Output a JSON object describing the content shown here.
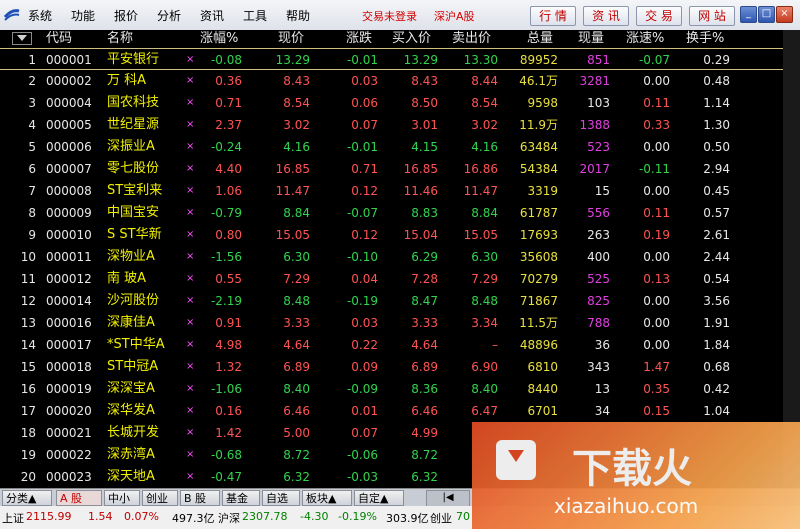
{
  "menu": [
    "系统",
    "功能",
    "报价",
    "分析",
    "资讯",
    "工具",
    "帮助"
  ],
  "status": {
    "trade_login": "交易未登录",
    "market": "深沪A股"
  },
  "toolbar": {
    "quote": "行 情",
    "info": "资 讯",
    "trade": "交 易",
    "site": "网 站"
  },
  "window_buttons": {
    "minimize": "_",
    "maximize": "□",
    "close": "×"
  },
  "columns": {
    "code": "代码",
    "name": "名称",
    "pct": "涨幅%",
    "price": "现价",
    "chg": "涨跌",
    "bid": "买入价",
    "ask": "卖出价",
    "vol": "总量",
    "cur": "现量",
    "spd": "涨速%",
    "turn": "换手%"
  },
  "rows": [
    {
      "idx": "1",
      "code": "000001",
      "name": "平安银行",
      "pct": "-0.08",
      "price": "13.29",
      "chg": "-0.01",
      "bid": "13.29",
      "ask": "13.30",
      "vol": "89952",
      "cur": "851",
      "spd": "-0.07",
      "turn": "0.29"
    },
    {
      "idx": "2",
      "code": "000002",
      "name": "万  科A",
      "pct": "0.36",
      "price": "8.43",
      "chg": "0.03",
      "bid": "8.43",
      "ask": "8.44",
      "vol": "46.1万",
      "cur": "3281",
      "spd": "0.00",
      "turn": "0.48"
    },
    {
      "idx": "3",
      "code": "000004",
      "name": "国农科技",
      "pct": "0.71",
      "price": "8.54",
      "chg": "0.06",
      "bid": "8.50",
      "ask": "8.54",
      "vol": "9598",
      "cur": "103",
      "spd": "0.11",
      "turn": "1.14"
    },
    {
      "idx": "4",
      "code": "000005",
      "name": "世纪星源",
      "pct": "2.37",
      "price": "3.02",
      "chg": "0.07",
      "bid": "3.01",
      "ask": "3.02",
      "vol": "11.9万",
      "cur": "1388",
      "spd": "0.33",
      "turn": "1.30"
    },
    {
      "idx": "5",
      "code": "000006",
      "name": "深振业A",
      "pct": "-0.24",
      "price": "4.16",
      "chg": "-0.01",
      "bid": "4.15",
      "ask": "4.16",
      "vol": "63484",
      "cur": "523",
      "spd": "0.00",
      "turn": "0.50"
    },
    {
      "idx": "6",
      "code": "000007",
      "name": "零七股份",
      "pct": "4.40",
      "price": "16.85",
      "chg": "0.71",
      "bid": "16.85",
      "ask": "16.86",
      "vol": "54384",
      "cur": "2017",
      "spd": "-0.11",
      "turn": "2.94"
    },
    {
      "idx": "7",
      "code": "000008",
      "name": "ST宝利来",
      "pct": "1.06",
      "price": "11.47",
      "chg": "0.12",
      "bid": "11.46",
      "ask": "11.47",
      "vol": "3319",
      "cur": "15",
      "spd": "0.00",
      "turn": "0.45"
    },
    {
      "idx": "8",
      "code": "000009",
      "name": "中国宝安",
      "pct": "-0.79",
      "price": "8.84",
      "chg": "-0.07",
      "bid": "8.83",
      "ask": "8.84",
      "vol": "61787",
      "cur": "556",
      "spd": "0.11",
      "turn": "0.57"
    },
    {
      "idx": "9",
      "code": "000010",
      "name": "S ST华新",
      "pct": "0.80",
      "price": "15.05",
      "chg": "0.12",
      "bid": "15.04",
      "ask": "15.05",
      "vol": "17693",
      "cur": "263",
      "spd": "0.19",
      "turn": "2.61"
    },
    {
      "idx": "10",
      "code": "000011",
      "name": "深物业A",
      "pct": "-1.56",
      "price": "6.30",
      "chg": "-0.10",
      "bid": "6.29",
      "ask": "6.30",
      "vol": "35608",
      "cur": "400",
      "spd": "0.00",
      "turn": "2.44"
    },
    {
      "idx": "11",
      "code": "000012",
      "name": "南  玻A",
      "pct": "0.55",
      "price": "7.29",
      "chg": "0.04",
      "bid": "7.28",
      "ask": "7.29",
      "vol": "70279",
      "cur": "525",
      "spd": "0.13",
      "turn": "0.54"
    },
    {
      "idx": "12",
      "code": "000014",
      "name": "沙河股份",
      "pct": "-2.19",
      "price": "8.48",
      "chg": "-0.19",
      "bid": "8.47",
      "ask": "8.48",
      "vol": "71867",
      "cur": "825",
      "spd": "0.00",
      "turn": "3.56"
    },
    {
      "idx": "13",
      "code": "000016",
      "name": "深康佳A",
      "pct": "0.91",
      "price": "3.33",
      "chg": "0.03",
      "bid": "3.33",
      "ask": "3.34",
      "vol": "11.5万",
      "cur": "788",
      "spd": "0.00",
      "turn": "1.91"
    },
    {
      "idx": "14",
      "code": "000017",
      "name": "*ST中华A",
      "pct": "4.98",
      "price": "4.64",
      "chg": "0.22",
      "bid": "4.64",
      "ask": "–",
      "vol": "48896",
      "cur": "36",
      "spd": "0.00",
      "turn": "1.84"
    },
    {
      "idx": "15",
      "code": "000018",
      "name": "ST中冠A",
      "pct": "1.32",
      "price": "6.89",
      "chg": "0.09",
      "bid": "6.89",
      "ask": "6.90",
      "vol": "6810",
      "cur": "343",
      "spd": "1.47",
      "turn": "0.68"
    },
    {
      "idx": "16",
      "code": "000019",
      "name": "深深宝A",
      "pct": "-1.06",
      "price": "8.40",
      "chg": "-0.09",
      "bid": "8.36",
      "ask": "8.40",
      "vol": "8440",
      "cur": "13",
      "spd": "0.35",
      "turn": "0.42"
    },
    {
      "idx": "17",
      "code": "000020",
      "name": "深华发A",
      "pct": "0.16",
      "price": "6.46",
      "chg": "0.01",
      "bid": "6.46",
      "ask": "6.47",
      "vol": "6701",
      "cur": "34",
      "spd": "0.15",
      "turn": "1.04"
    },
    {
      "idx": "18",
      "code": "000021",
      "name": "长城开发",
      "pct": "1.42",
      "price": "5.00",
      "chg": "0.07",
      "bid": "4.99",
      "ask": "",
      "vol": "",
      "cur": "",
      "spd": "",
      "turn": ""
    },
    {
      "idx": "19",
      "code": "000022",
      "name": "深赤湾A",
      "pct": "-0.68",
      "price": "8.72",
      "chg": "-0.06",
      "bid": "8.72",
      "ask": "",
      "vol": "",
      "cur": "",
      "spd": "",
      "turn": ""
    },
    {
      "idx": "20",
      "code": "000023",
      "name": "深天地A",
      "pct": "-0.47",
      "price": "6.32",
      "chg": "-0.03",
      "bid": "6.32",
      "ask": "",
      "vol": "",
      "cur": "",
      "spd": "",
      "turn": ""
    }
  ],
  "tabs": [
    "分类▲",
    "A 股",
    "中小",
    "创业",
    "B 股",
    "基金",
    "自选",
    "板块▲",
    "自定▲"
  ],
  "ticker": {
    "sh_label": "上证",
    "sh_val": "2115.99",
    "sh_chg": "1.54",
    "sh_pct": "0.07%",
    "sh_amt": "497.3亿",
    "sz_label": "沪深",
    "sz_val": "2307.78",
    "sz_chg": "-4.30",
    "sz_pct": "-0.19%",
    "sz_amt": "303.9亿",
    "cy_label": "创业",
    "cy_val": "70"
  },
  "watermark": {
    "title": "下载火",
    "url": "xiazaihuo.com"
  }
}
